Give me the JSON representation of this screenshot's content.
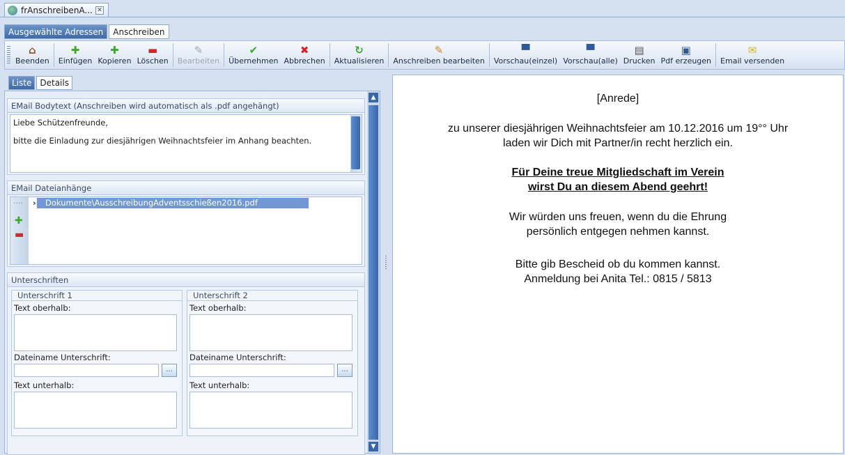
{
  "doc_tab": {
    "title": "frAnschreibenA...",
    "close": "✕"
  },
  "view_tabs": [
    "Ausgewählte Adressen",
    "Anschreiben"
  ],
  "toolbar": {
    "beenden": "Beenden",
    "einfuegen": "Einfügen",
    "kopieren": "Kopieren",
    "loeschen": "Löschen",
    "bearbeiten": "Bearbeiten",
    "uebernehmen": "Übernehmen",
    "abbrechen": "Abbrechen",
    "aktualisieren": "Aktualisieren",
    "anschreiben_bearbeiten": "Anschreiben bearbeiten",
    "vorschau_einzel": "Vorschau(einzel)",
    "vorschau_alle": "Vorschau(alle)",
    "drucken": "Drucken",
    "pdf_erzeugen": "Pdf erzeugen",
    "email_versenden": "Email versenden"
  },
  "panel_tabs": [
    "Liste",
    "Details"
  ],
  "email_body": {
    "header": "EMail Bodytext (Anschreiben wird automatisch als .pdf angehängt)",
    "line1": "Liebe Schützenfreunde,",
    "line2": "bitte die Einladung zur diesjährigen Weihnachtsfeier im Anhang beachten."
  },
  "attachments": {
    "header": "EMail Dateianhänge",
    "items": [
      "Dokumente\\AusschreibungAdventsschießen2016.pdf"
    ]
  },
  "signatures": {
    "header": "Unterschriften",
    "s1": {
      "title": "Unterschrift 1",
      "above": "Text oberhalb:",
      "file": "Dateiname Unterschrift:",
      "below": "Text unterhalb:"
    },
    "s2": {
      "title": "Unterschrift 2",
      "above": "Text oberhalb:",
      "file": "Dateiname Unterschrift:",
      "below": "Text unterhalb:"
    },
    "browse": "..."
  },
  "preview": {
    "anrede": "[Anrede]",
    "p1": "zu unserer diesjährigen Weihnachtsfeier am 10.12.2016 um 19°° Uhr",
    "p2": "laden wir Dich mit Partner/in recht herzlich ein.",
    "b1": "Für Deine treue Mitgliedschaft im Verein",
    "b2": "wirst Du an diesem Abend geehrt!",
    "p3": "Wir würden uns freuen, wenn du die Ehrung",
    "p4": "persönlich entgegen nehmen kannst.",
    "p5": "Bitte gib Bescheid ob du kommen kannst.",
    "p6": "Anmeldung bei Anita Tel.: 0815 / 5813"
  },
  "colors": {
    "accent": "#3e6aa8",
    "selection": "#7397d4",
    "add": "#3ea82c",
    "delete": "#d9232c",
    "apply": "#3ea82c"
  }
}
